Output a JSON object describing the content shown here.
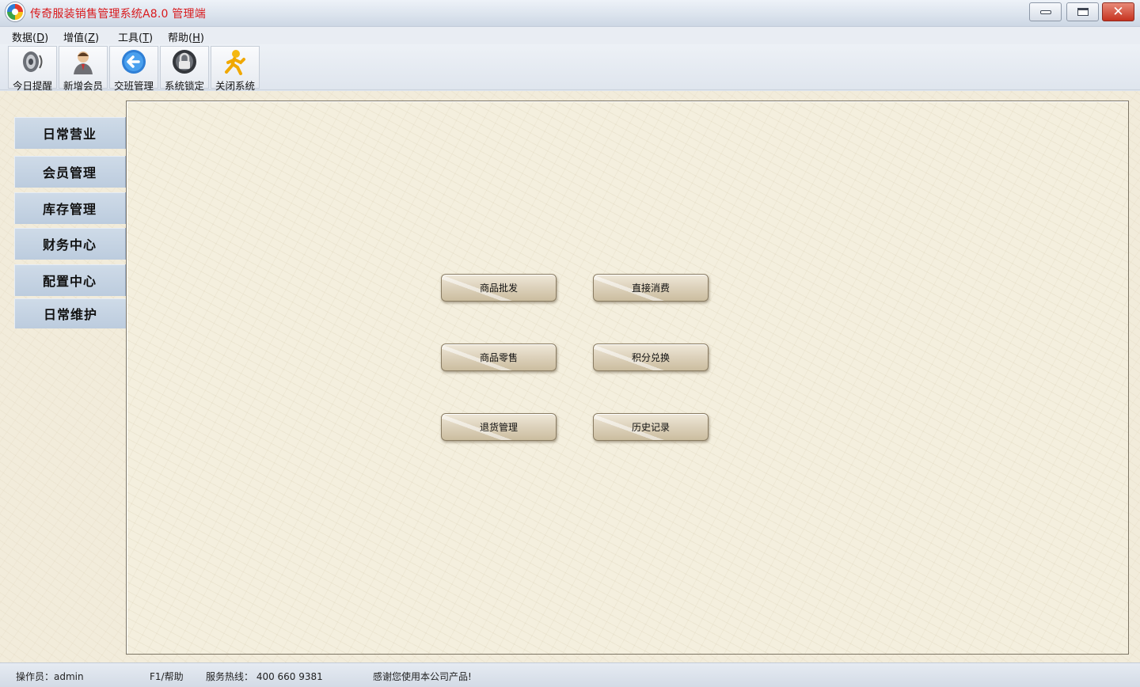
{
  "window": {
    "title": "传奇服装销售管理系统A8.0 管理端",
    "controls": {
      "minimize_icon": "minimize-icon",
      "maximize_icon": "maximize-icon",
      "close_glyph": "✕"
    }
  },
  "menu": [
    {
      "label": "数据(",
      "accel": "D",
      "tail": ")"
    },
    {
      "label": "增值(",
      "accel": "Z",
      "tail": ")"
    },
    {
      "label": "工具(",
      "accel": "T",
      "tail": ")"
    },
    {
      "label": "帮助(",
      "accel": "H",
      "tail": ")"
    }
  ],
  "toolbar": [
    {
      "label": "今日提醒",
      "icon": "speaker-icon"
    },
    {
      "label": "新增会员",
      "icon": "user-icon"
    },
    {
      "label": "交班管理",
      "icon": "back-arrow-icon"
    },
    {
      "label": "系统锁定",
      "icon": "lock-icon"
    },
    {
      "label": "关闭系统",
      "icon": "exit-person-icon"
    }
  ],
  "sidebar": [
    {
      "label": "日常营业"
    },
    {
      "label": "会员管理"
    },
    {
      "label": "库存管理"
    },
    {
      "label": "财务中心"
    },
    {
      "label": "配置中心"
    },
    {
      "label": "日常维护"
    }
  ],
  "actions": [
    {
      "label": "商品批发"
    },
    {
      "label": "直接消费"
    },
    {
      "label": "商品零售"
    },
    {
      "label": "积分兑换"
    },
    {
      "label": "退货管理"
    },
    {
      "label": "历史记录"
    }
  ],
  "status": {
    "operator": "操作员：admin",
    "help": "F1/帮助",
    "hotline": "服务热线： 400 660 9381",
    "thanks": "感谢您使用本公司产品!"
  },
  "colors": {
    "title": "#d9191c",
    "sidebar": "#c5d3e3",
    "panel": "#f4efde"
  }
}
